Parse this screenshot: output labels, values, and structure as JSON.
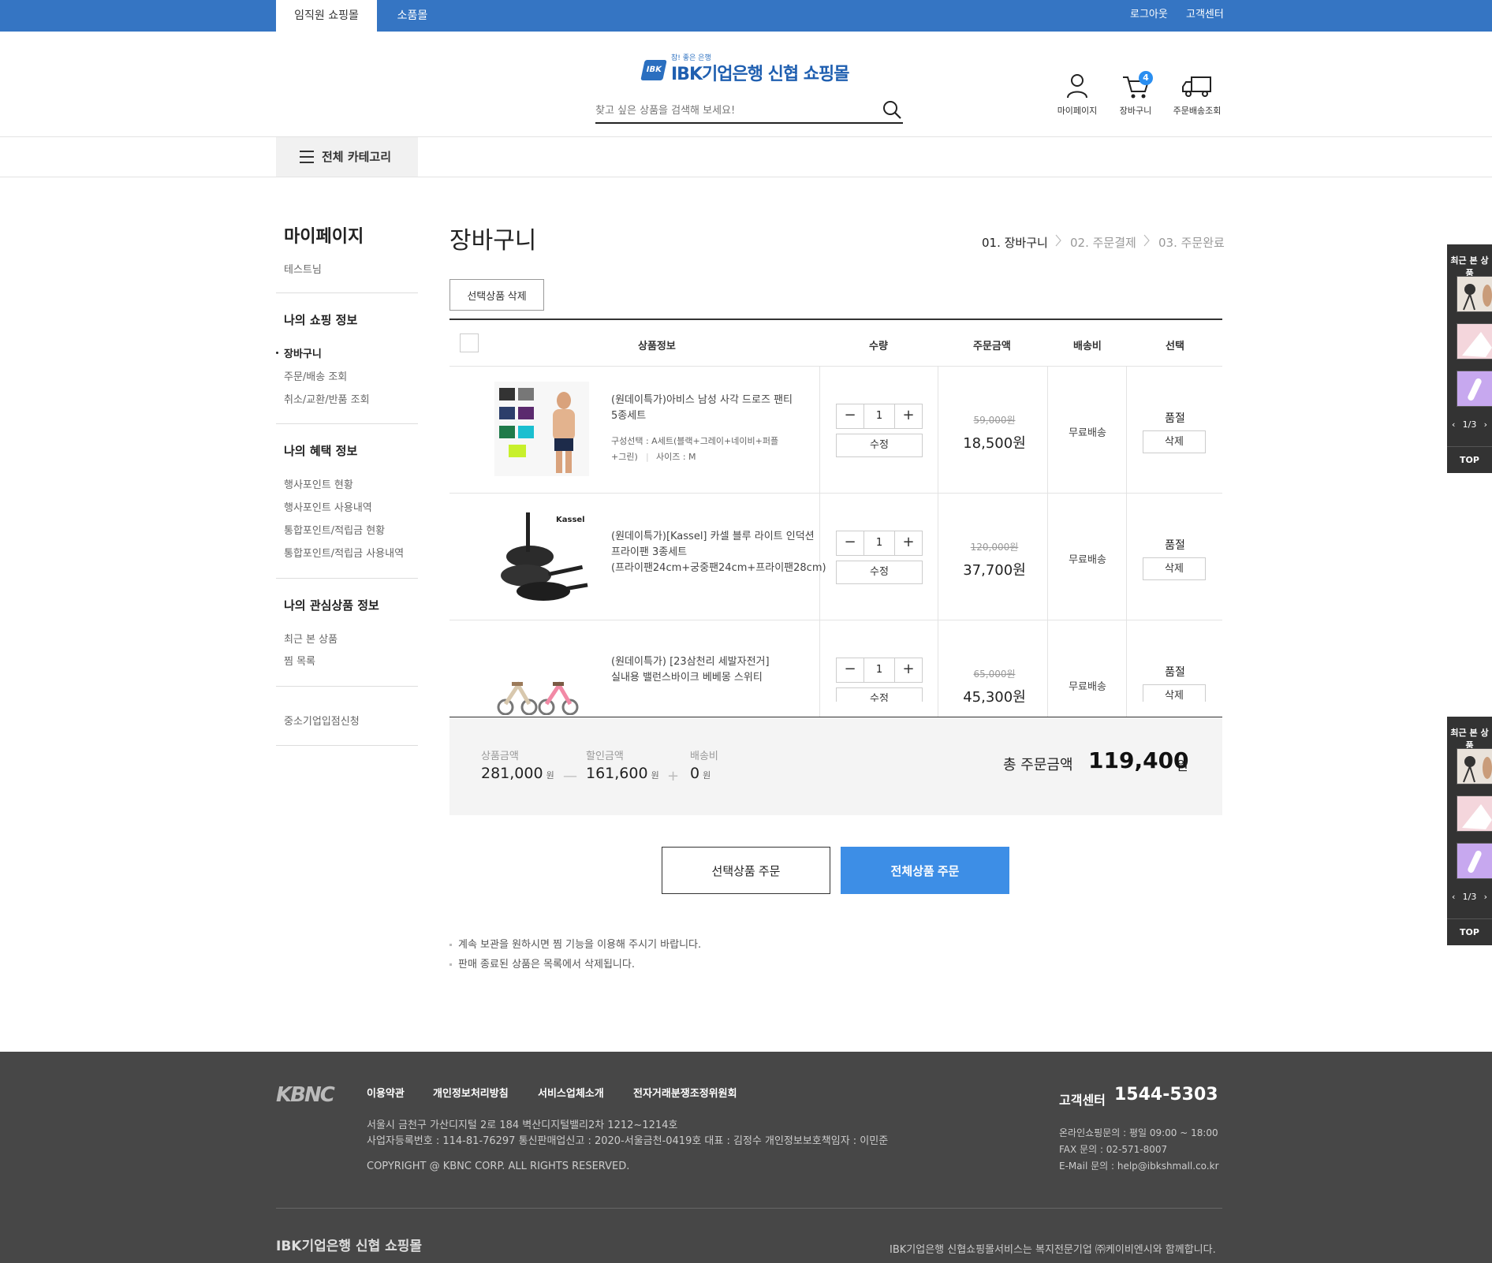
{
  "topbar": {
    "tabs": [
      {
        "label": "임직원 쇼핑몰",
        "active": true
      },
      {
        "label": "소품몰",
        "active": false
      }
    ],
    "logout": "로그아웃",
    "customer_center": "고객센터"
  },
  "header": {
    "logo_small": "참! 좋은 은행",
    "logo_mark": "IBK",
    "logo_text": "IBK기업은행 신협 쇼핑몰",
    "search_placeholder": "찾고 싶은 상품을 검색해 보세요!",
    "icons": [
      {
        "name": "person-icon",
        "label": "마이페이지"
      },
      {
        "name": "cart-icon",
        "label": "장바구니",
        "badge": "4"
      },
      {
        "name": "truck-icon",
        "label": "주문배송조회"
      }
    ]
  },
  "nav": {
    "category_label": "전체 카테고리"
  },
  "sidebar": {
    "title": "마이페이지",
    "user": "테스트님",
    "sections": [
      {
        "heading": "나의 쇼핑 정보",
        "items": [
          "장바구니",
          "주문/배송 조회",
          "취소/교환/반품 조회"
        ]
      },
      {
        "heading": "나의 혜택 정보",
        "items": [
          "행사포인트 현황",
          "행사포인트 사용내역",
          "통합포인트/적립금 현황",
          "통합포인트/적립금 사용내역"
        ]
      },
      {
        "heading": "나의 관심상품 정보",
        "items": [
          "최근 본 상품",
          "찜 목록"
        ]
      }
    ],
    "extra": "중소기업입점신청"
  },
  "cart": {
    "title": "장바구니",
    "steps": [
      "01. 장바구니",
      "02. 주문결제",
      "03. 주문완료"
    ],
    "delete_selected": "선택상품 삭제",
    "headers": [
      "상품정보",
      "수량",
      "주문금액",
      "배송비",
      "선택"
    ],
    "items": [
      {
        "name": "(원데이특가)아비스 남성 사각 드로즈 팬티 5종세트",
        "name_line1": "(원데이특가)아비스 남성 사각 드로즈 팬티",
        "name_line2": "5종세트",
        "option_line1": "구성선택 : A세트(블랙+그레이+네이비+퍼플",
        "option_line2": "+그린)",
        "option_sep": "|",
        "option_size": "사이즈 : M",
        "qty": "1",
        "edit": "수정",
        "old_price": "59,000원",
        "price": "18,500원",
        "shipping": "무료배송",
        "status": "품절",
        "delete": "삭제"
      },
      {
        "name_line1": "(원데이특가)[Kassel] 카셀 블루 라이트 인덕션",
        "name_line2": "프라이팬 3종세트",
        "name_line3": "(프라이팬24cm+궁중팬24cm+프라이팬28cm)",
        "brand": "Kassel",
        "qty": "1",
        "edit": "수정",
        "old_price": "120,000원",
        "price": "37,700원",
        "shipping": "무료배송",
        "status": "품절",
        "delete": "삭제"
      },
      {
        "name_line1": "(원데이특가) [23삼천리 세발자전거]",
        "name_line2": "실내용 밸런스바이크 베베몽 스위티",
        "qty": "1",
        "edit": "수정",
        "old_price": "65,000원",
        "price": "45,300원",
        "shipping": "무료배송",
        "status": "품절",
        "delete": "삭제"
      }
    ],
    "summary": {
      "product_label": "상품금액",
      "product_value": "281,000",
      "unit": "원",
      "discount_label": "할인금액",
      "discount_value": "161,600",
      "shipping_label": "배송비",
      "shipping_value": "0",
      "minus": "—",
      "plus": "+",
      "total_label": "총 주문금액",
      "total_value": "119,400",
      "total_unit": "원"
    },
    "order_selected": "선택상품 주문",
    "order_all": "전체상품 주문",
    "notes": [
      "계속 보관을 원하시면 찜 기능을 이용해 주시기 바랍니다.",
      "판매 종료된 상품은 목록에서 삭제됩니다."
    ]
  },
  "quick_panel": {
    "title": "최근 본 상품",
    "page": "1/3",
    "top": "TOP"
  },
  "footer": {
    "logo": "KBNC",
    "links": [
      "이용약관",
      "개인정보처리방침",
      "서비스업체소개",
      "전자거래분쟁조정위원회"
    ],
    "address": "서울시 금천구 가산디지털 2로 184 벽산디지털밸리2차 1212~1214호",
    "business": "사업자등록번호 : 114-81-76297 통신판매업신고 : 2020-서울금천-0419호 대표 : 김정수 개인정보보호책임자 : 이민준",
    "copyright": "COPYRIGHT @ KBNC CORP. ALL RIGHTS RESERVED.",
    "cs_label": "고객센터",
    "cs_phone": "1544-5303",
    "cs_hours": "온라인쇼핑문의 : 평일 09:00 ~ 18:00",
    "fax": "FAX 문의 : 02-571-8007",
    "email": "E-Mail 문의 : help@ibkshmall.co.kr",
    "bottom_logo": "IBK기업은행 신협 쇼핑몰",
    "bottom_copy": "IBK기업은행 신협쇼핑몰서비스는 복지전문기업 ㈜케이비엔시와 함께합니다."
  }
}
